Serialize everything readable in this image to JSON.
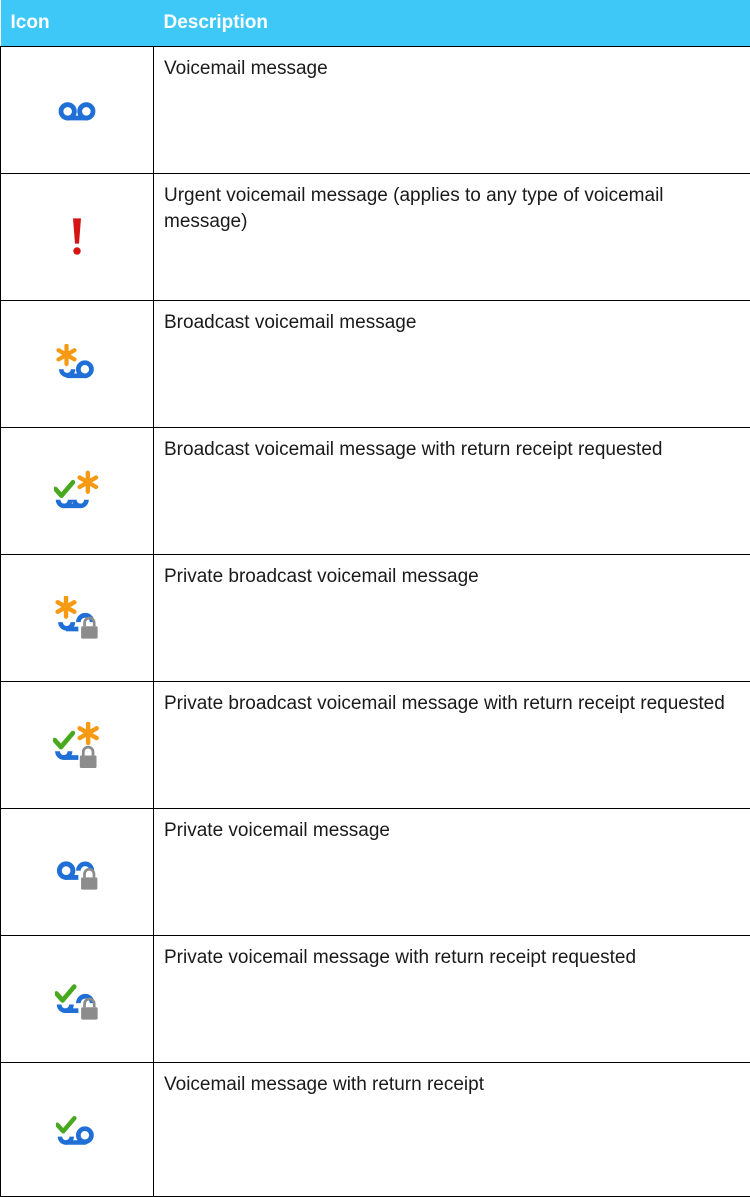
{
  "header": {
    "icon_col": "Icon",
    "description_col": "Description"
  },
  "colors": {
    "header_bg": "#3ec8f8",
    "voicemail_blue": "#1f6fd6",
    "urgent_red": "#d51414",
    "broadcast_orange": "#f59a12",
    "receipt_green": "#48a81e",
    "lock_gray": "#8c8c8c"
  },
  "rows": [
    {
      "icon": "voicemail-icon",
      "description": "Voicemail message"
    },
    {
      "icon": "urgent-icon",
      "description": "Urgent voicemail message (applies to any type of voicemail message)"
    },
    {
      "icon": "broadcast-voicemail-icon",
      "description": "Broadcast voicemail message"
    },
    {
      "icon": "broadcast-return-receipt-icon",
      "description": "Broadcast voicemail message with return receipt requested"
    },
    {
      "icon": "private-broadcast-icon",
      "description": "Private broadcast voicemail message"
    },
    {
      "icon": "private-broadcast-return-receipt-icon",
      "description": "Private broadcast voicemail message with return receipt requested"
    },
    {
      "icon": "private-voicemail-icon",
      "description": "Private voicemail message"
    },
    {
      "icon": "private-return-receipt-icon",
      "description": "Private voicemail message with return receipt requested"
    },
    {
      "icon": "voicemail-return-receipt-icon",
      "description": "Voicemail message with return receipt"
    }
  ]
}
